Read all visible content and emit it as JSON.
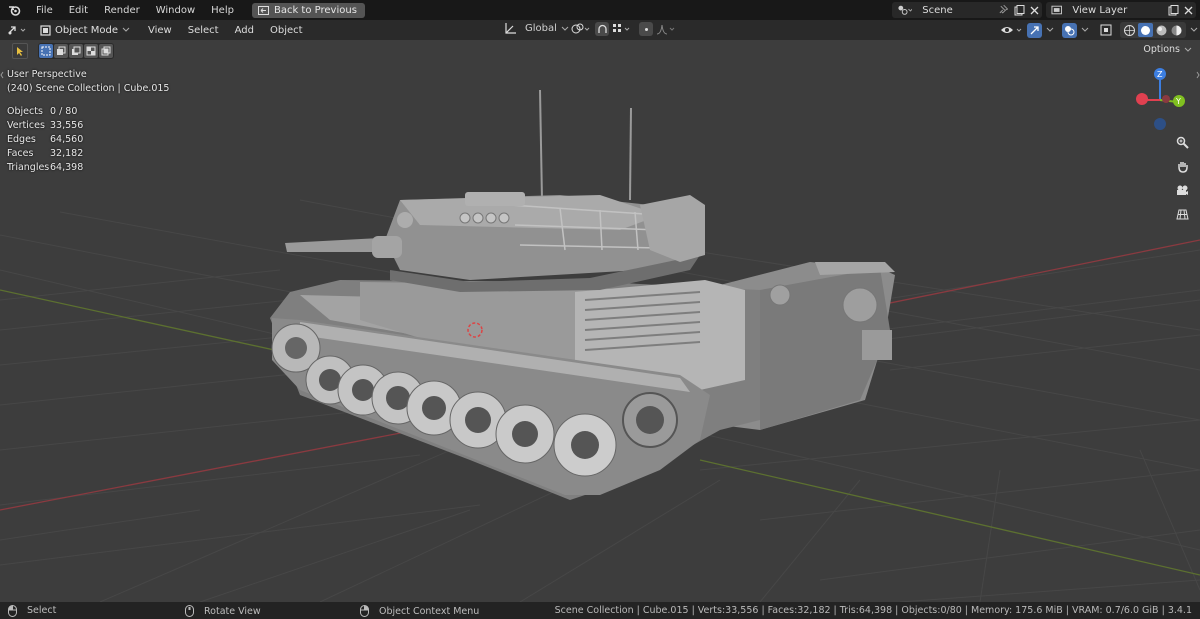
{
  "menu": {
    "items": [
      "File",
      "Edit",
      "Render",
      "Window",
      "Help"
    ],
    "back_button": "Back to Previous"
  },
  "scene": {
    "label": "Scene"
  },
  "view_layer": {
    "label": "View Layer"
  },
  "header": {
    "mode": "Object Mode",
    "menus": [
      "View",
      "Select",
      "Add",
      "Object"
    ],
    "orientation": "Global"
  },
  "options_label": "Options",
  "overlay": {
    "perspective": "User Perspective",
    "collection": "(240) Scene Collection | Cube.015",
    "stats": [
      {
        "label": "Objects",
        "value": "0 / 80"
      },
      {
        "label": "Vertices",
        "value": "33,556"
      },
      {
        "label": "Edges",
        "value": "64,560"
      },
      {
        "label": "Faces",
        "value": "32,182"
      },
      {
        "label": "Triangles",
        "value": "64,398"
      }
    ]
  },
  "gizmo": {
    "z": "Z",
    "y": "Y"
  },
  "status": {
    "select": "Select",
    "rotate": "Rotate View",
    "context": "Object Context Menu",
    "info": "Scene Collection | Cube.015 | Verts:33,556 | Faces:32,182 | Tris:64,398 | Objects:0/80 | Memory: 175.6 MiB | VRAM: 0.7/6.0 GiB | 3.4.1"
  },
  "colors": {
    "accent": "#4772b3",
    "x_axis": "#e04050",
    "y_axis": "#80c020",
    "z_axis": "#3c7ee0"
  }
}
